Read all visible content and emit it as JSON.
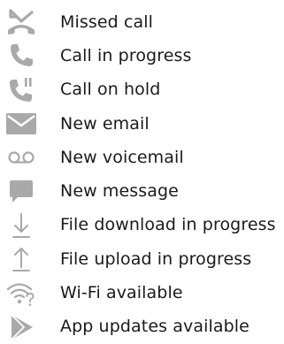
{
  "colors": {
    "icon": "#a9a9a9",
    "text": "#1a1a1a",
    "background": "#ffffff"
  },
  "items": [
    {
      "icon": "missed-call-icon",
      "label": "Missed call"
    },
    {
      "icon": "call-in-progress-icon",
      "label": "Call in progress"
    },
    {
      "icon": "call-on-hold-icon",
      "label": "Call on hold"
    },
    {
      "icon": "new-email-icon",
      "label": "New email"
    },
    {
      "icon": "new-voicemail-icon",
      "label": "New voicemail"
    },
    {
      "icon": "new-message-icon",
      "label": "New message"
    },
    {
      "icon": "file-download-icon",
      "label": "File download in progress"
    },
    {
      "icon": "file-upload-icon",
      "label": "File upload in progress"
    },
    {
      "icon": "wifi-available-icon",
      "label": "Wi-Fi available"
    },
    {
      "icon": "app-updates-icon",
      "label": "App updates available"
    }
  ]
}
